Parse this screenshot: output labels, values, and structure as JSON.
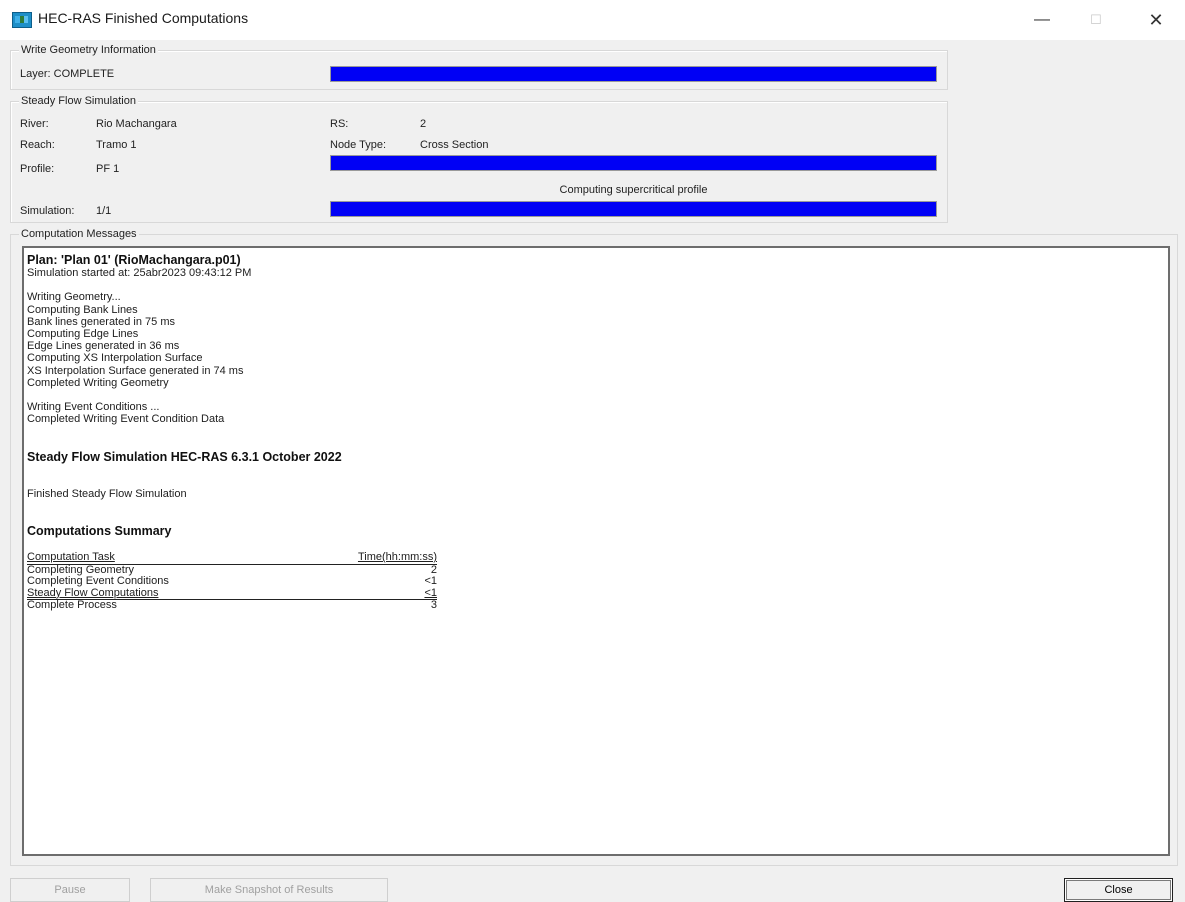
{
  "window": {
    "title": "HEC-RAS Finished Computations",
    "controls": {
      "minimize": "—",
      "maximize": "☐",
      "close": "✕"
    },
    "icon": "hec-ras-app-icon"
  },
  "geometry_group": {
    "legend": "Write Geometry Information",
    "layer_label": "Layer: COMPLETE",
    "progress": 1.0
  },
  "steady_group": {
    "legend": "Steady Flow Simulation",
    "river_label": "River:",
    "river_value": "Rio Machangara",
    "reach_label": "Reach:",
    "reach_value": "Tramo 1",
    "profile_label": "Profile:",
    "profile_value": "PF 1",
    "rs_label": "RS:",
    "rs_value": "2",
    "node_label": "Node Type:",
    "node_value": "Cross Section",
    "status_text": "Computing supercritical profile",
    "simulation_label": "Simulation:",
    "simulation_value": "1/1",
    "profile_progress": 1.0,
    "simulation_progress": 1.0
  },
  "messages": {
    "legend": "Computation Messages",
    "plan_heading": "Plan: 'Plan 01' (RioMachangara.p01)",
    "started": "Simulation started at: 25abr2023 09:43:12 PM",
    "geometry_lines": [
      "Writing Geometry...",
      "Computing Bank Lines",
      "Bank lines generated in 75 ms",
      "Computing Edge Lines",
      "Edge Lines generated in 36 ms",
      "Computing XS Interpolation Surface",
      "XS Interpolation Surface generated in 74 ms",
      "Completed Writing Geometry"
    ],
    "event_lines": [
      "Writing Event Conditions ...",
      "Completed Writing Event Condition Data"
    ],
    "steady_heading": "Steady Flow Simulation HEC-RAS 6.3.1 October 2022",
    "finished": "Finished Steady Flow Simulation",
    "summary_heading": "Computations Summary",
    "summary": {
      "col_task": "Computation Task",
      "col_time": "Time(hh:mm:ss)",
      "rows": [
        {
          "task": "Completing Geometry",
          "time": "2"
        },
        {
          "task": "Completing Event Conditions",
          "time": "<1"
        },
        {
          "task": "Steady Flow Computations",
          "time": "<1"
        },
        {
          "task": "Complete Process",
          "time": "3"
        }
      ]
    }
  },
  "buttons": {
    "pause": "Pause",
    "snapshot": "Make Snapshot of Results",
    "close": "Close"
  },
  "colors": {
    "progress_fill": "#0000f5",
    "window_bg": "#f0f0f0"
  }
}
